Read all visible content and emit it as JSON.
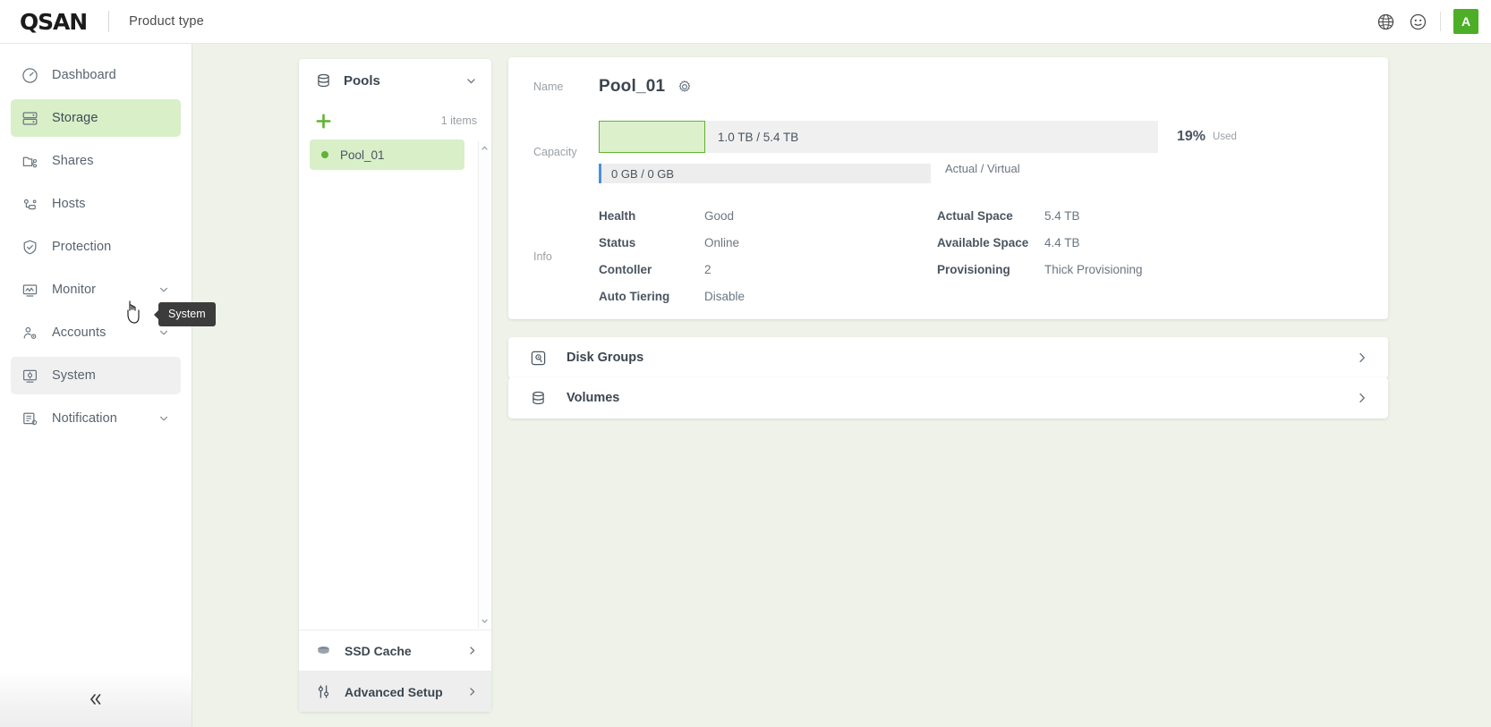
{
  "header": {
    "logo": "QSAN",
    "product_type": "Product type",
    "icons": [
      "globe-icon",
      "support-icon"
    ],
    "avatar_initial": "A"
  },
  "sidebar": {
    "items": [
      {
        "label": "Dashboard",
        "icon": "gauge-icon",
        "active": false,
        "chevron": false,
        "hovered": false
      },
      {
        "label": "Storage",
        "icon": "server-icon",
        "active": true,
        "chevron": false,
        "hovered": false
      },
      {
        "label": "Shares",
        "icon": "folder-share-icon",
        "active": false,
        "chevron": false,
        "hovered": false
      },
      {
        "label": "Hosts",
        "icon": "hosts-icon",
        "active": false,
        "chevron": false,
        "hovered": false
      },
      {
        "label": "Protection",
        "icon": "shield-check-icon",
        "active": false,
        "chevron": false,
        "hovered": false
      },
      {
        "label": "Monitor",
        "icon": "monitor-icon",
        "active": false,
        "chevron": true,
        "hovered": false
      },
      {
        "label": "Accounts",
        "icon": "user-gear-icon",
        "active": false,
        "chevron": true,
        "hovered": false
      },
      {
        "label": "System",
        "icon": "system-gear-icon",
        "active": false,
        "chevron": false,
        "hovered": true
      },
      {
        "label": "Notification",
        "icon": "notification-icon",
        "active": false,
        "chevron": true,
        "hovered": false
      }
    ],
    "tooltip": "System",
    "collapse_icon": "double-chevron-left-icon"
  },
  "pools_panel": {
    "title": "Pools",
    "icon": "database-icon",
    "add_icon": "plus-icon",
    "items_count": "1 items",
    "pools": [
      {
        "name": "Pool_01",
        "selected": true,
        "status_color": "#62b234"
      }
    ],
    "footer_rows": [
      {
        "label": "SSD Cache",
        "icon": "ssd-cache-icon",
        "hovered": false
      },
      {
        "label": "Advanced Setup",
        "icon": "sliders-icon",
        "hovered": true
      }
    ]
  },
  "detail": {
    "name_label": "Name",
    "pool_name": "Pool_01",
    "gear_icon": "gear-icon",
    "capacity_label": "Capacity",
    "capacity": {
      "used_text": "1.0 TB / 5.4 TB",
      "percent": "19%",
      "percent_sub": "Used",
      "fill_ratio": 0.19,
      "virtual_text": "0 GB / 0 GB",
      "virtual_sub": "Actual / Virtual"
    },
    "info_label": "Info",
    "info": [
      {
        "key": "Health",
        "value": "Good",
        "key2": "Actual Space",
        "value2": "5.4 TB"
      },
      {
        "key": "Status",
        "value": "Online",
        "key2": "Available Space",
        "value2": "4.4 TB"
      },
      {
        "key": "Contoller",
        "value": "2",
        "key2": "Provisioning",
        "value2": "Thick Provisioning"
      },
      {
        "key": "Auto Tiering",
        "value": "Disable",
        "key2": "",
        "value2": ""
      }
    ],
    "sections": [
      {
        "label": "Disk Groups",
        "icon": "disk-group-icon"
      },
      {
        "label": "Volumes",
        "icon": "volumes-icon"
      }
    ]
  },
  "colors": {
    "accent_green": "#62b234",
    "active_bg": "#d8efc8",
    "content_bg": "#eef2e8",
    "blue_marker": "#4a90d9"
  }
}
